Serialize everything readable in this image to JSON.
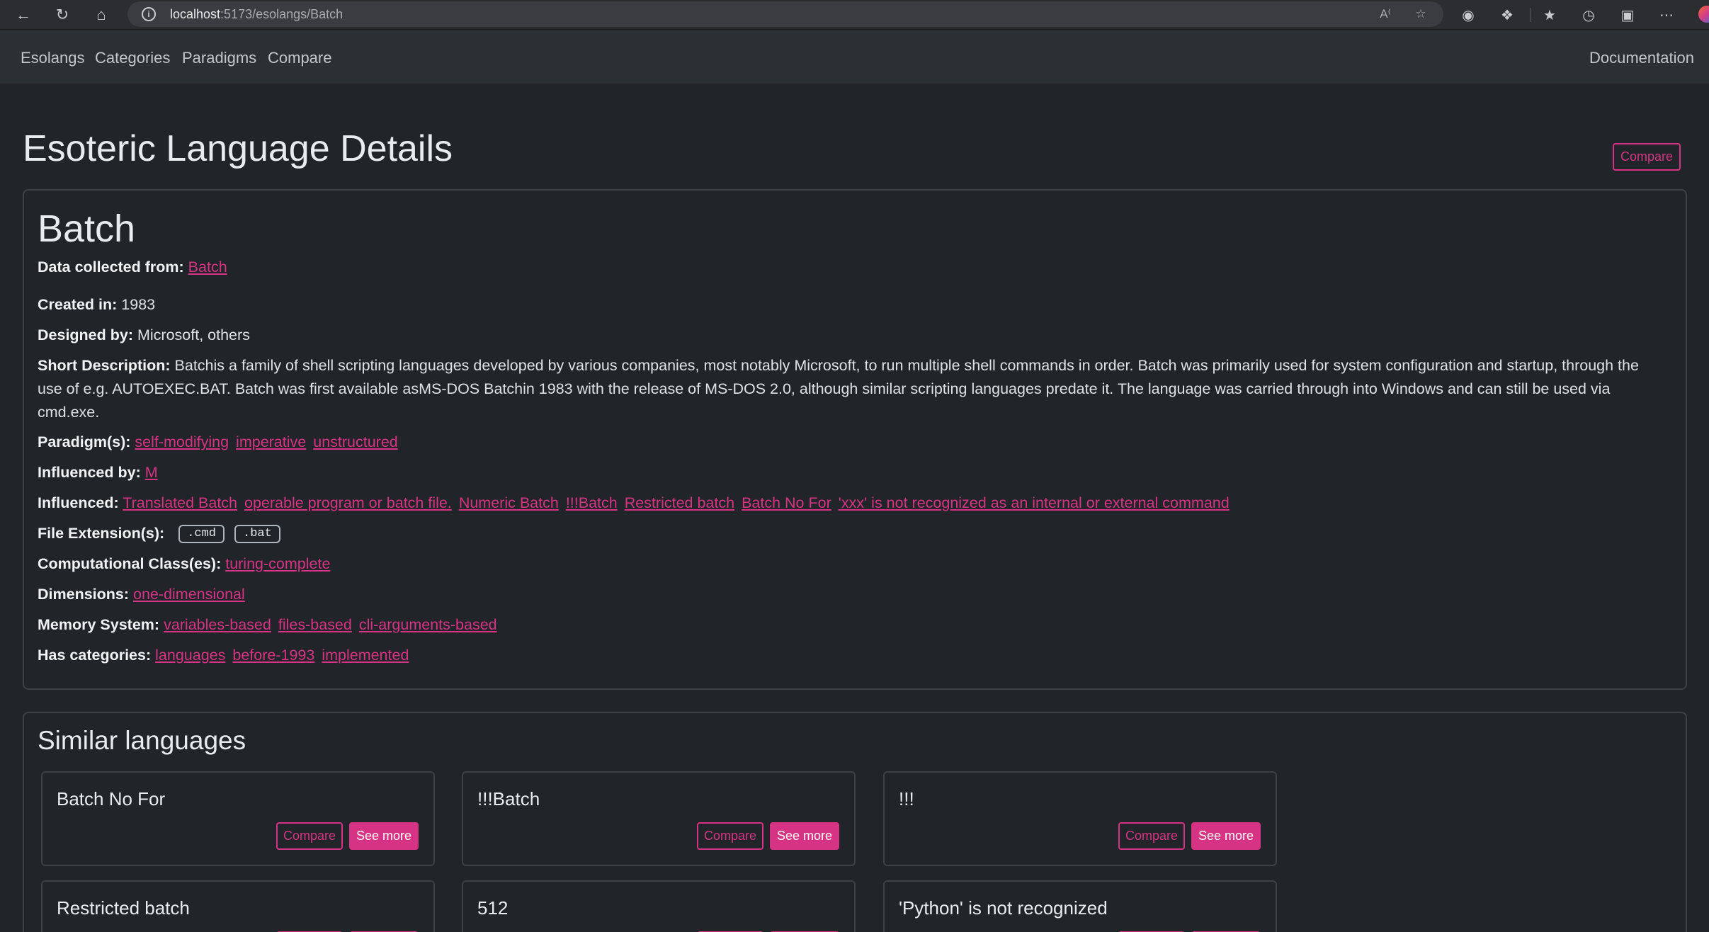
{
  "browser": {
    "url_host": "localhost",
    "url_path": ":5173/esolangs/Batch"
  },
  "nav": {
    "links": [
      "Esolangs",
      "Categories",
      "Paradigms",
      "Compare"
    ],
    "right_link": "Documentation"
  },
  "page": {
    "title": "Esoteric Language Details",
    "compare_label": "Compare"
  },
  "language": {
    "name": "Batch",
    "data_source_label": "Data collected from:",
    "data_source": "Batch",
    "created_label": "Created in:",
    "created": "1983",
    "designed_label": "Designed by:",
    "designed": "Microsoft, others",
    "description_label": "Short Description:",
    "description": "Batchis a family of shell scripting languages developed by various companies, most notably Microsoft, to run multiple shell commands in order. Batch was primarily used for system configuration and startup, through the use of e.g. AUTOEXEC.BAT. Batch was first available asMS-DOS Batchin 1983 with the release of MS-DOS 2.0, although similar scripting languages predate it. The language was carried through into Windows and can still be used via cmd.exe.",
    "paradigms_label": "Paradigm(s):",
    "paradigms": [
      "self-modifying",
      "imperative",
      "unstructured"
    ],
    "influenced_by_label": "Influenced by:",
    "influenced_by": [
      "M"
    ],
    "influenced_label": "Influenced:",
    "influenced": [
      "Translated Batch",
      "operable program or batch file.",
      "Numeric Batch",
      "!!!Batch",
      "Restricted batch",
      "Batch No For",
      "'xxx' is not recognized as an internal or external command"
    ],
    "extensions_label": "File Extension(s):",
    "extensions": [
      ".cmd",
      ".bat"
    ],
    "computational_label": "Computational Class(es):",
    "computational": [
      "turing-complete"
    ],
    "dimensions_label": "Dimensions:",
    "dimensions": [
      "one-dimensional"
    ],
    "memory_label": "Memory System:",
    "memory": [
      "variables-based",
      "files-based",
      "cli-arguments-based"
    ],
    "categories_label": "Has categories:",
    "categories": [
      "languages",
      "before-1993",
      "implemented"
    ]
  },
  "similar": {
    "title": "Similar languages",
    "compare_label": "Compare",
    "see_more_label": "See more",
    "items": [
      "Batch No For",
      "!!!Batch",
      "!!!",
      "Restricted batch",
      "512",
      "'Python' is not recognized"
    ]
  },
  "colors": {
    "accent": "#d63384",
    "background": "#212529",
    "navbar": "#2b3035"
  }
}
